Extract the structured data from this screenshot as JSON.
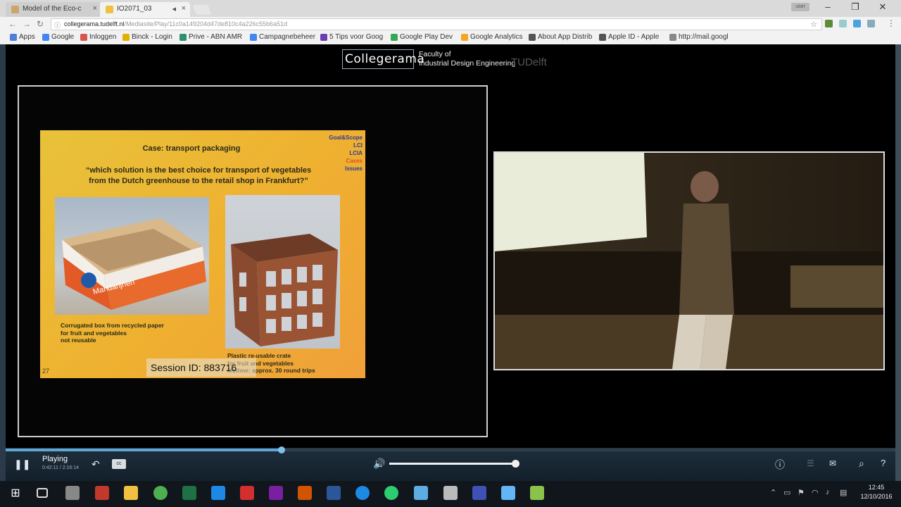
{
  "browser": {
    "tabs": [
      {
        "label": "Model of the Eco-c",
        "active": false
      },
      {
        "label": "IO2071_03",
        "active": true
      }
    ],
    "window_controls": {
      "minimize": "–",
      "maximize": "❐",
      "close": "✕"
    },
    "user_badge": "user",
    "address": {
      "host": "collegerama.tudelft.nl",
      "path": "/Mediasite/Play/11c0a149204d47de810c4a226c55b6a51d"
    },
    "bookmarks": [
      {
        "label": "Apps",
        "color": "#4f7fd9"
      },
      {
        "label": "Google",
        "color": "#4285f4"
      },
      {
        "label": "Inloggen",
        "color": "#d9534f"
      },
      {
        "label": "Binck - Login",
        "color": "#e2b100"
      },
      {
        "label": "Prive - ABN AMR",
        "color": "#2f8f6f"
      },
      {
        "label": "Campagnebeheer",
        "color": "#4285f4"
      },
      {
        "label": "5 Tips voor Goog",
        "color": "#6a3fb5"
      },
      {
        "label": "Google Play Dev",
        "color": "#34a853"
      },
      {
        "label": "Google Analytics",
        "color": "#f5a623"
      },
      {
        "label": "About App Distrib",
        "color": "#555555"
      },
      {
        "label": "Apple ID - Apple",
        "color": "#555555"
      },
      {
        "label": "http://mail.googl",
        "color": "#888888"
      }
    ]
  },
  "player": {
    "logo_text": "Collegerama",
    "faculty_line1": "Faculty of",
    "faculty_line2": "Industrial Design Engineering",
    "tudelft": "TUDelft",
    "slide": {
      "title": "Case: transport packaging",
      "question_line1": "“which solution is the best choice for transport of vegetables",
      "question_line2": "from the Dutch greenhouse to the retail shop in Frankfurt?”",
      "menu": [
        "Goal&Scope",
        "LCI",
        "LCIA",
        "Cases",
        "Issues"
      ],
      "menu_highlight": "Cases",
      "caption1_lines": [
        "Corrugated box from recycled paper",
        "for fruit and vegetables",
        "not reusable"
      ],
      "caption2_lines": [
        "Plastic re-usable crate",
        "for fruit and vegetables",
        "lifetime: approx. 30 round trips"
      ],
      "box_brand": "Mandarijnen",
      "page_number": "27"
    },
    "session_label": "Session ID: 883716",
    "status": "Playing",
    "current_time": "0:42:11",
    "total_time": "2:16:14",
    "progress": 0.31,
    "volume": 0.97,
    "cc_label": "cc"
  },
  "taskbar": {
    "apps": [
      {
        "name": "start",
        "color": "#ffffff"
      },
      {
        "name": "task-view",
        "color": "#dddddd"
      },
      {
        "name": "app-3",
        "color": "#888888"
      },
      {
        "name": "app-4",
        "color": "#c0392b"
      },
      {
        "name": "file-explorer",
        "color": "#f0c040"
      },
      {
        "name": "chrome",
        "color": "#4caf50"
      },
      {
        "name": "excel",
        "color": "#1e7145"
      },
      {
        "name": "edge",
        "color": "#1e88e5"
      },
      {
        "name": "acrobat",
        "color": "#d32f2f"
      },
      {
        "name": "onenote",
        "color": "#7b1fa2"
      },
      {
        "name": "powerpoint",
        "color": "#d35400"
      },
      {
        "name": "word",
        "color": "#2b579a"
      },
      {
        "name": "app-13",
        "color": "#1e88e5"
      },
      {
        "name": "app-14",
        "color": "#2ecc71"
      },
      {
        "name": "app-15",
        "color": "#5dade2"
      },
      {
        "name": "app-16",
        "color": "#bbbbbb"
      },
      {
        "name": "app-17",
        "color": "#3f51b5"
      },
      {
        "name": "app-18",
        "color": "#64b5f6"
      },
      {
        "name": "app-19",
        "color": "#8bc34a"
      }
    ],
    "time": "12:45",
    "date": "12/10/2016"
  }
}
